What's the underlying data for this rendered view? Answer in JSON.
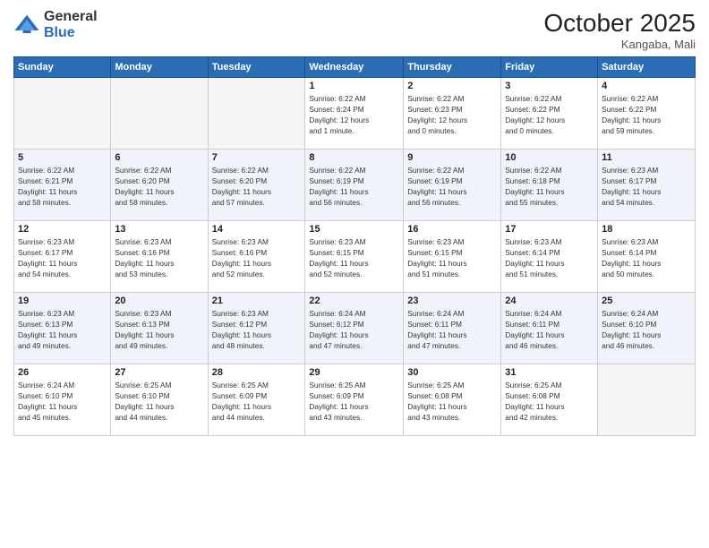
{
  "logo": {
    "general": "General",
    "blue": "Blue"
  },
  "title": "October 2025",
  "location": "Kangaba, Mali",
  "days_header": [
    "Sunday",
    "Monday",
    "Tuesday",
    "Wednesday",
    "Thursday",
    "Friday",
    "Saturday"
  ],
  "weeks": [
    [
      {
        "day": "",
        "info": ""
      },
      {
        "day": "",
        "info": ""
      },
      {
        "day": "",
        "info": ""
      },
      {
        "day": "1",
        "info": "Sunrise: 6:22 AM\nSunset: 6:24 PM\nDaylight: 12 hours\nand 1 minute."
      },
      {
        "day": "2",
        "info": "Sunrise: 6:22 AM\nSunset: 6:23 PM\nDaylight: 12 hours\nand 0 minutes."
      },
      {
        "day": "3",
        "info": "Sunrise: 6:22 AM\nSunset: 6:22 PM\nDaylight: 12 hours\nand 0 minutes."
      },
      {
        "day": "4",
        "info": "Sunrise: 6:22 AM\nSunset: 6:22 PM\nDaylight: 11 hours\nand 59 minutes."
      }
    ],
    [
      {
        "day": "5",
        "info": "Sunrise: 6:22 AM\nSunset: 6:21 PM\nDaylight: 11 hours\nand 58 minutes."
      },
      {
        "day": "6",
        "info": "Sunrise: 6:22 AM\nSunset: 6:20 PM\nDaylight: 11 hours\nand 58 minutes."
      },
      {
        "day": "7",
        "info": "Sunrise: 6:22 AM\nSunset: 6:20 PM\nDaylight: 11 hours\nand 57 minutes."
      },
      {
        "day": "8",
        "info": "Sunrise: 6:22 AM\nSunset: 6:19 PM\nDaylight: 11 hours\nand 56 minutes."
      },
      {
        "day": "9",
        "info": "Sunrise: 6:22 AM\nSunset: 6:19 PM\nDaylight: 11 hours\nand 56 minutes."
      },
      {
        "day": "10",
        "info": "Sunrise: 6:22 AM\nSunset: 6:18 PM\nDaylight: 11 hours\nand 55 minutes."
      },
      {
        "day": "11",
        "info": "Sunrise: 6:23 AM\nSunset: 6:17 PM\nDaylight: 11 hours\nand 54 minutes."
      }
    ],
    [
      {
        "day": "12",
        "info": "Sunrise: 6:23 AM\nSunset: 6:17 PM\nDaylight: 11 hours\nand 54 minutes."
      },
      {
        "day": "13",
        "info": "Sunrise: 6:23 AM\nSunset: 6:16 PM\nDaylight: 11 hours\nand 53 minutes."
      },
      {
        "day": "14",
        "info": "Sunrise: 6:23 AM\nSunset: 6:16 PM\nDaylight: 11 hours\nand 52 minutes."
      },
      {
        "day": "15",
        "info": "Sunrise: 6:23 AM\nSunset: 6:15 PM\nDaylight: 11 hours\nand 52 minutes."
      },
      {
        "day": "16",
        "info": "Sunrise: 6:23 AM\nSunset: 6:15 PM\nDaylight: 11 hours\nand 51 minutes."
      },
      {
        "day": "17",
        "info": "Sunrise: 6:23 AM\nSunset: 6:14 PM\nDaylight: 11 hours\nand 51 minutes."
      },
      {
        "day": "18",
        "info": "Sunrise: 6:23 AM\nSunset: 6:14 PM\nDaylight: 11 hours\nand 50 minutes."
      }
    ],
    [
      {
        "day": "19",
        "info": "Sunrise: 6:23 AM\nSunset: 6:13 PM\nDaylight: 11 hours\nand 49 minutes."
      },
      {
        "day": "20",
        "info": "Sunrise: 6:23 AM\nSunset: 6:13 PM\nDaylight: 11 hours\nand 49 minutes."
      },
      {
        "day": "21",
        "info": "Sunrise: 6:23 AM\nSunset: 6:12 PM\nDaylight: 11 hours\nand 48 minutes."
      },
      {
        "day": "22",
        "info": "Sunrise: 6:24 AM\nSunset: 6:12 PM\nDaylight: 11 hours\nand 47 minutes."
      },
      {
        "day": "23",
        "info": "Sunrise: 6:24 AM\nSunset: 6:11 PM\nDaylight: 11 hours\nand 47 minutes."
      },
      {
        "day": "24",
        "info": "Sunrise: 6:24 AM\nSunset: 6:11 PM\nDaylight: 11 hours\nand 46 minutes."
      },
      {
        "day": "25",
        "info": "Sunrise: 6:24 AM\nSunset: 6:10 PM\nDaylight: 11 hours\nand 46 minutes."
      }
    ],
    [
      {
        "day": "26",
        "info": "Sunrise: 6:24 AM\nSunset: 6:10 PM\nDaylight: 11 hours\nand 45 minutes."
      },
      {
        "day": "27",
        "info": "Sunrise: 6:25 AM\nSunset: 6:10 PM\nDaylight: 11 hours\nand 44 minutes."
      },
      {
        "day": "28",
        "info": "Sunrise: 6:25 AM\nSunset: 6:09 PM\nDaylight: 11 hours\nand 44 minutes."
      },
      {
        "day": "29",
        "info": "Sunrise: 6:25 AM\nSunset: 6:09 PM\nDaylight: 11 hours\nand 43 minutes."
      },
      {
        "day": "30",
        "info": "Sunrise: 6:25 AM\nSunset: 6:08 PM\nDaylight: 11 hours\nand 43 minutes."
      },
      {
        "day": "31",
        "info": "Sunrise: 6:25 AM\nSunset: 6:08 PM\nDaylight: 11 hours\nand 42 minutes."
      },
      {
        "day": "",
        "info": ""
      }
    ]
  ]
}
